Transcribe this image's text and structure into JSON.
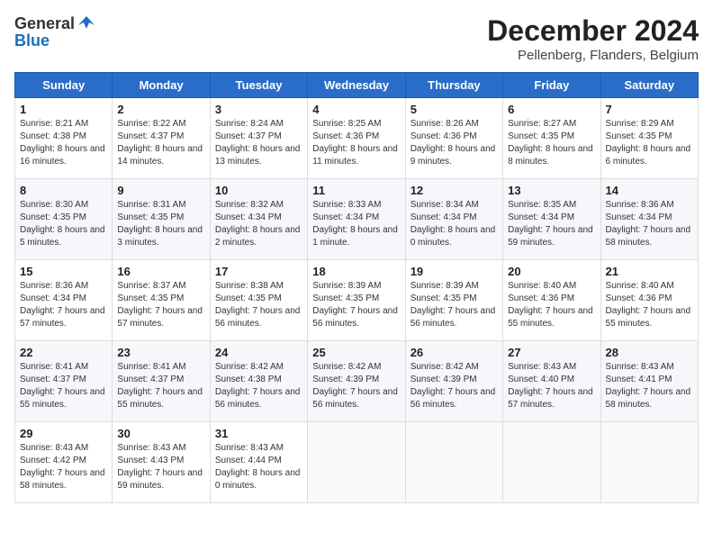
{
  "header": {
    "logo_general": "General",
    "logo_blue": "Blue",
    "title": "December 2024",
    "subtitle": "Pellenberg, Flanders, Belgium"
  },
  "calendar": {
    "days_of_week": [
      "Sunday",
      "Monday",
      "Tuesday",
      "Wednesday",
      "Thursday",
      "Friday",
      "Saturday"
    ],
    "weeks": [
      [
        {
          "day": "1",
          "sunrise": "8:21 AM",
          "sunset": "4:38 PM",
          "daylight": "8 hours and 16 minutes."
        },
        {
          "day": "2",
          "sunrise": "8:22 AM",
          "sunset": "4:37 PM",
          "daylight": "8 hours and 14 minutes."
        },
        {
          "day": "3",
          "sunrise": "8:24 AM",
          "sunset": "4:37 PM",
          "daylight": "8 hours and 13 minutes."
        },
        {
          "day": "4",
          "sunrise": "8:25 AM",
          "sunset": "4:36 PM",
          "daylight": "8 hours and 11 minutes."
        },
        {
          "day": "5",
          "sunrise": "8:26 AM",
          "sunset": "4:36 PM",
          "daylight": "8 hours and 9 minutes."
        },
        {
          "day": "6",
          "sunrise": "8:27 AM",
          "sunset": "4:35 PM",
          "daylight": "8 hours and 8 minutes."
        },
        {
          "day": "7",
          "sunrise": "8:29 AM",
          "sunset": "4:35 PM",
          "daylight": "8 hours and 6 minutes."
        }
      ],
      [
        {
          "day": "8",
          "sunrise": "8:30 AM",
          "sunset": "4:35 PM",
          "daylight": "8 hours and 5 minutes."
        },
        {
          "day": "9",
          "sunrise": "8:31 AM",
          "sunset": "4:35 PM",
          "daylight": "8 hours and 3 minutes."
        },
        {
          "day": "10",
          "sunrise": "8:32 AM",
          "sunset": "4:34 PM",
          "daylight": "8 hours and 2 minutes."
        },
        {
          "day": "11",
          "sunrise": "8:33 AM",
          "sunset": "4:34 PM",
          "daylight": "8 hours and 1 minute."
        },
        {
          "day": "12",
          "sunrise": "8:34 AM",
          "sunset": "4:34 PM",
          "daylight": "8 hours and 0 minutes."
        },
        {
          "day": "13",
          "sunrise": "8:35 AM",
          "sunset": "4:34 PM",
          "daylight": "7 hours and 59 minutes."
        },
        {
          "day": "14",
          "sunrise": "8:36 AM",
          "sunset": "4:34 PM",
          "daylight": "7 hours and 58 minutes."
        }
      ],
      [
        {
          "day": "15",
          "sunrise": "8:36 AM",
          "sunset": "4:34 PM",
          "daylight": "7 hours and 57 minutes."
        },
        {
          "day": "16",
          "sunrise": "8:37 AM",
          "sunset": "4:35 PM",
          "daylight": "7 hours and 57 minutes."
        },
        {
          "day": "17",
          "sunrise": "8:38 AM",
          "sunset": "4:35 PM",
          "daylight": "7 hours and 56 minutes."
        },
        {
          "day": "18",
          "sunrise": "8:39 AM",
          "sunset": "4:35 PM",
          "daylight": "7 hours and 56 minutes."
        },
        {
          "day": "19",
          "sunrise": "8:39 AM",
          "sunset": "4:35 PM",
          "daylight": "7 hours and 56 minutes."
        },
        {
          "day": "20",
          "sunrise": "8:40 AM",
          "sunset": "4:36 PM",
          "daylight": "7 hours and 55 minutes."
        },
        {
          "day": "21",
          "sunrise": "8:40 AM",
          "sunset": "4:36 PM",
          "daylight": "7 hours and 55 minutes."
        }
      ],
      [
        {
          "day": "22",
          "sunrise": "8:41 AM",
          "sunset": "4:37 PM",
          "daylight": "7 hours and 55 minutes."
        },
        {
          "day": "23",
          "sunrise": "8:41 AM",
          "sunset": "4:37 PM",
          "daylight": "7 hours and 55 minutes."
        },
        {
          "day": "24",
          "sunrise": "8:42 AM",
          "sunset": "4:38 PM",
          "daylight": "7 hours and 56 minutes."
        },
        {
          "day": "25",
          "sunrise": "8:42 AM",
          "sunset": "4:39 PM",
          "daylight": "7 hours and 56 minutes."
        },
        {
          "day": "26",
          "sunrise": "8:42 AM",
          "sunset": "4:39 PM",
          "daylight": "7 hours and 56 minutes."
        },
        {
          "day": "27",
          "sunrise": "8:43 AM",
          "sunset": "4:40 PM",
          "daylight": "7 hours and 57 minutes."
        },
        {
          "day": "28",
          "sunrise": "8:43 AM",
          "sunset": "4:41 PM",
          "daylight": "7 hours and 58 minutes."
        }
      ],
      [
        {
          "day": "29",
          "sunrise": "8:43 AM",
          "sunset": "4:42 PM",
          "daylight": "7 hours and 58 minutes."
        },
        {
          "day": "30",
          "sunrise": "8:43 AM",
          "sunset": "4:43 PM",
          "daylight": "7 hours and 59 minutes."
        },
        {
          "day": "31",
          "sunrise": "8:43 AM",
          "sunset": "4:44 PM",
          "daylight": "8 hours and 0 minutes."
        },
        null,
        null,
        null,
        null
      ]
    ]
  }
}
